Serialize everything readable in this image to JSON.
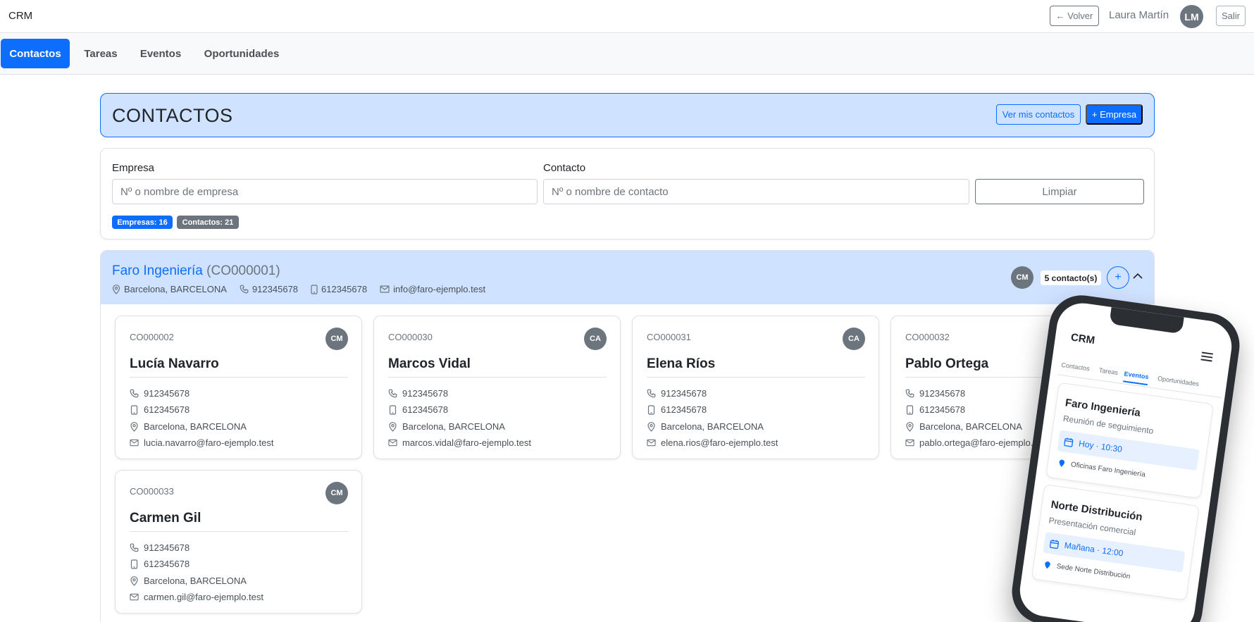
{
  "app": {
    "brand": "CRM"
  },
  "topbar": {
    "back_label": "← Volver",
    "user_name": "Laura Martín",
    "user_initials": "LM",
    "logout_label": "Salir"
  },
  "nav": {
    "tabs": [
      {
        "label": "Contactos",
        "active": true
      },
      {
        "label": "Tareas",
        "active": false
      },
      {
        "label": "Eventos",
        "active": false
      },
      {
        "label": "Oportunidades",
        "active": false
      }
    ]
  },
  "header": {
    "title": "CONTACTOS",
    "my_contacts_label": "Ver mis contactos",
    "add_company_label": "+ Empresa"
  },
  "filters": {
    "company_label": "Empresa",
    "company_placeholder": "Nº o nombre de empresa",
    "contact_label": "Contacto",
    "contact_placeholder": "Nº o nombre de contacto",
    "clear_label": "Limpiar",
    "badge_companies": "Empresas: 16",
    "badge_contacts": "Contactos: 21"
  },
  "company": {
    "name": "Faro Ingeniería",
    "code": "(CO000001)",
    "location": "Barcelona, BARCELONA",
    "phone": "912345678",
    "mobile": "612345678",
    "email": "info@faro-ejemplo.test",
    "owner_initials": "CM",
    "contact_count": "5 contacto(s)",
    "add_label": "+"
  },
  "contacts": [
    {
      "code": "CO000002",
      "initials": "CM",
      "name": "Lucía Navarro",
      "phone": "912345678",
      "mobile": "612345678",
      "location": "Barcelona, BARCELONA",
      "email": "lucia.navarro@faro-ejemplo.test"
    },
    {
      "code": "CO000030",
      "initials": "CA",
      "name": "Marcos Vidal",
      "phone": "912345678",
      "mobile": "612345678",
      "location": "Barcelona, BARCELONA",
      "email": "marcos.vidal@faro-ejemplo.test"
    },
    {
      "code": "CO000031",
      "initials": "CA",
      "name": "Elena Ríos",
      "phone": "912345678",
      "mobile": "612345678",
      "location": "Barcelona, BARCELONA",
      "email": "elena.rios@faro-ejemplo.test"
    },
    {
      "code": "CO000032",
      "initials": "",
      "name": "Pablo Ortega",
      "phone": "912345678",
      "mobile": "612345678",
      "location": "Barcelona, BARCELONA",
      "email": "pablo.ortega@faro-ejemplo.test"
    },
    {
      "code": "CO000033",
      "initials": "CM",
      "name": "Carmen Gil",
      "phone": "912345678",
      "mobile": "612345678",
      "location": "Barcelona, BARCELONA",
      "email": "carmen.gil@faro-ejemplo.test"
    }
  ],
  "phone": {
    "brand": "CRM",
    "tabs": [
      "Contactos",
      "Tareas",
      "Eventos",
      "Oportunidades"
    ],
    "events": [
      {
        "title": "Faro Ingeniería",
        "subtitle": "Reunión de seguimiento",
        "when": "Hoy · 10:30",
        "where": "Oficinas Faro Ingeniería"
      },
      {
        "title": "Norte Distribución",
        "subtitle": "Presentación comercial",
        "when": "Mañana · 12:00",
        "where": "Sede Norte Distribución"
      }
    ]
  },
  "colors": {
    "primary": "#0d6efd",
    "header_bg": "#cfe2ff",
    "secondary": "#6c757d"
  }
}
